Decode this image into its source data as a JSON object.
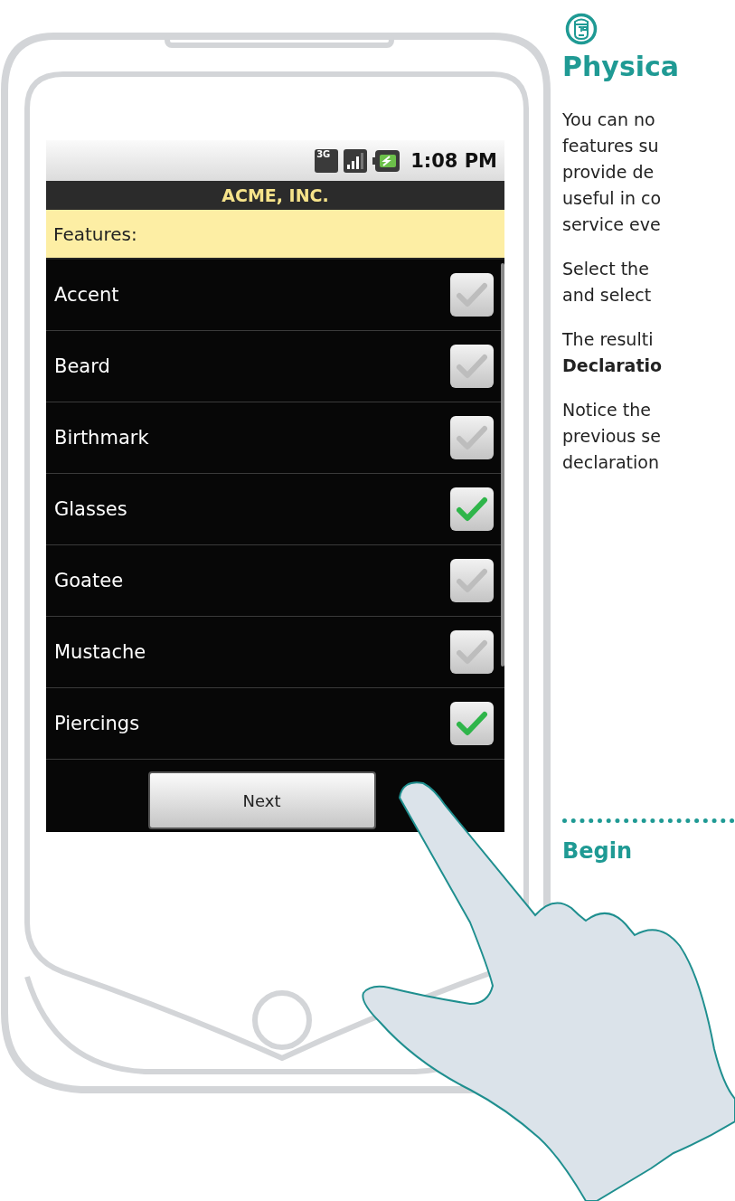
{
  "phone_screen": {
    "status_bar": {
      "network_label": "3G",
      "time": "1:08 PM"
    },
    "app_title": "ACME, INC.",
    "section_header": "Features:",
    "features": [
      {
        "label": "Accent",
        "checked": false
      },
      {
        "label": "Beard",
        "checked": false
      },
      {
        "label": "Birthmark",
        "checked": false
      },
      {
        "label": "Glasses",
        "checked": true
      },
      {
        "label": "Goatee",
        "checked": false
      },
      {
        "label": "Mustache",
        "checked": false
      },
      {
        "label": "Piercings",
        "checked": true
      }
    ],
    "button": "Next"
  },
  "article": {
    "heading": "Physica",
    "paragraphs": [
      [
        "You can no",
        "features su",
        "provide de",
        "useful in co",
        "service eve"
      ],
      [
        "Select the",
        "and select"
      ],
      [
        "The resulti",
        "**Declaratio**"
      ],
      [
        "Notice the",
        "previous se",
        "declaration"
      ]
    ],
    "link": "Begin"
  }
}
